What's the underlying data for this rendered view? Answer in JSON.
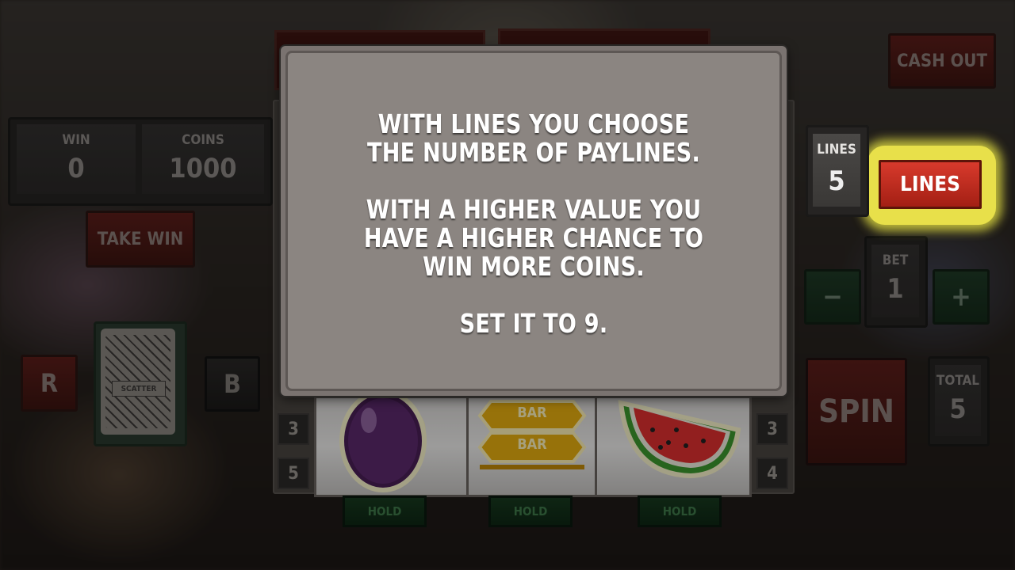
{
  "top_right": {
    "cash_out": "CASH OUT"
  },
  "stats": {
    "win_label": "WIN",
    "win_value": "0",
    "coins_label": "COINS",
    "coins_value": "1000"
  },
  "take_win": "TAKE WIN",
  "gamble": {
    "red_label": "R",
    "black_label": "B",
    "card_text": "SCATTER"
  },
  "lines": {
    "label": "LINES",
    "value": "5",
    "button_label": "LINES"
  },
  "bet": {
    "label": "BET",
    "value": "1",
    "minus": "−",
    "plus": "+"
  },
  "spin": "SPIN",
  "total": {
    "label": "TOTAL",
    "value": "5"
  },
  "reels": {
    "left_numbers": [
      "3",
      "5"
    ],
    "right_numbers": [
      "3",
      "4"
    ],
    "symbols": [
      "plum",
      "double-bar",
      "watermelon"
    ],
    "bar_text": "BAR",
    "hold_labels": [
      "HOLD",
      "HOLD",
      "HOLD"
    ]
  },
  "dialog": {
    "line1": "WITH LINES YOU CHOOSE THE NUMBER OF PAYLINES.",
    "line2": "WITH A HIGHER VALUE YOU HAVE A HIGHER CHANCE TO WIN MORE COINS.",
    "line3": "SET IT TO 9."
  },
  "colors": {
    "highlight": "#e8e04a",
    "button_red": "#c52d20",
    "dialog_bg": "#8b8581"
  }
}
